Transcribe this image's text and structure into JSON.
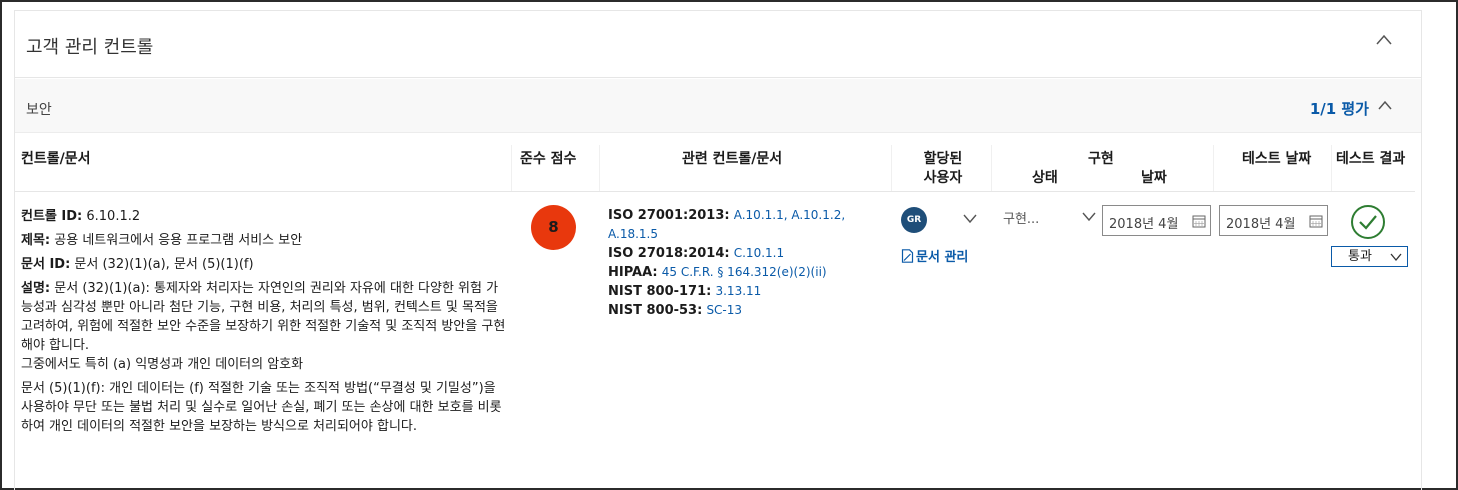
{
  "section": {
    "title": "고객 관리 컨트롤"
  },
  "group": {
    "name": "보안",
    "assessment": "1/1 평가"
  },
  "columns": {
    "control": "컨트롤/문서",
    "score": "준수 점수",
    "related": "관련 컨트롤/문서",
    "assigned_line1": "할당된",
    "assigned_line2": "사용자",
    "impl": "구현",
    "impl_status": "상태",
    "impl_date": "날짜",
    "test_date": "테스트 날짜",
    "test_result": "테스트 결과"
  },
  "row": {
    "control_id_label": "컨트롤 ID:",
    "control_id": "6.10.1.2",
    "title_label": "제목:",
    "title": "공용 네트워크에서 응용 프로그램 서비스 보안",
    "doc_id_label": "문서 ID:",
    "doc_id": "문서 (32)(1)(a), 문서 (5)(1)(f)",
    "desc_label": "설명:",
    "desc1": "문서 (32)(1)(a): 통제자와 처리자는 자연인의 권리와 자유에 대한 다양한 위험 가능성과 심각성 뿐만 아니라 첨단 기능, 구현 비용, 처리의 특성, 범위, 컨텍스트 및 목적을 고려하여, 위험에 적절한 보안 수준을 보장하기 위한 적절한 기술적 및 조직적 방안을 구현해야 합니다.",
    "desc2": "그중에서도 특히 (a) 익명성과 개인 데이터의 암호화",
    "desc3": "문서 (5)(1)(f): 개인 데이터는 (f) 적절한 기술 또는 조직적 방법(“무결성 및 기밀성”)을 사용하야 무단 또는 불법 처리 및 실수로 일어난 손실, 폐기 또는 손상에 대한 보호를 비롯하여 개인 데이터의 적절한 보안을 보장하는 방식으로 처리되어야 합니다.",
    "score": "8",
    "score_color": "#e8380d",
    "related": [
      {
        "std": "ISO 27001:2013:",
        "links": "A.10.1.1, A.10.1.2, A.18.1.5"
      },
      {
        "std": "ISO 27018:2014:",
        "links": "C.10.1.1"
      },
      {
        "std": "HIPAA:",
        "links": "45 C.F.R. § 164.312(e)(2)(ii)"
      },
      {
        "std": "NIST 800-171:",
        "links": "3.13.11"
      },
      {
        "std": "NIST 800-53:",
        "links": "SC-13"
      }
    ],
    "user_initials": "GR",
    "doc_manage": "문서 관리",
    "impl_status": "구현...",
    "impl_date": "2018년 4월",
    "test_date": "2018년 4월",
    "test_result": "통과"
  },
  "icons": [
    "chevron-up-icon",
    "chevron-down-icon",
    "document-icon",
    "calendar-icon",
    "check-circle-icon"
  ],
  "colors": {
    "accent": "#0a5aa8",
    "pass": "#2e7d32",
    "avatar": "#1f4e79"
  }
}
